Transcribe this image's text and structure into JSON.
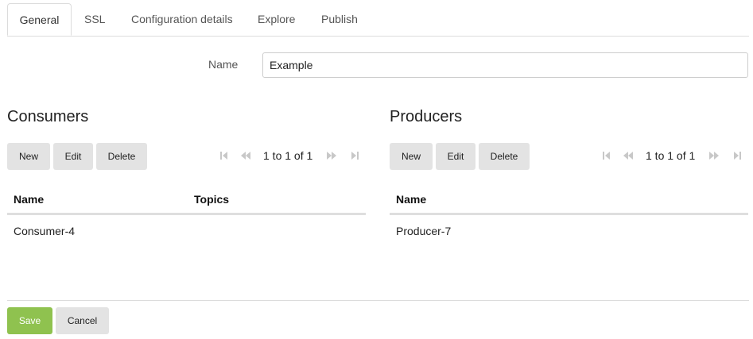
{
  "tabs": [
    {
      "label": "General",
      "active": true
    },
    {
      "label": "SSL"
    },
    {
      "label": "Configuration details"
    },
    {
      "label": "Explore"
    },
    {
      "label": "Publish"
    }
  ],
  "form": {
    "name_label": "Name",
    "name_value": "Example"
  },
  "consumers": {
    "title": "Consumers",
    "buttons": {
      "new": "New",
      "edit": "Edit",
      "delete": "Delete"
    },
    "pager": "1 to 1 of 1",
    "columns": [
      "Name",
      "Topics"
    ],
    "rows": [
      {
        "name": "Consumer-4",
        "topics": ""
      }
    ]
  },
  "producers": {
    "title": "Producers",
    "buttons": {
      "new": "New",
      "edit": "Edit",
      "delete": "Delete"
    },
    "pager": "1 to 1 of 1",
    "columns": [
      "Name"
    ],
    "rows": [
      {
        "name": "Producer-7"
      }
    ]
  },
  "footer": {
    "save": "Save",
    "cancel": "Cancel"
  },
  "colors": {
    "save": "#8fc24f",
    "button": "#e3e3e3",
    "pager_icon": "#c8c8c8"
  }
}
